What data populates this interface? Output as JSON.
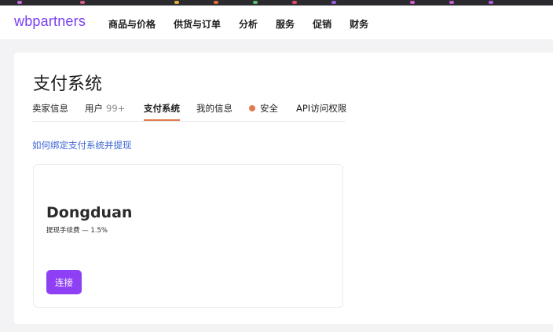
{
  "header": {
    "logo": "wbpartners",
    "nav": [
      "商品与价格",
      "供货与订单",
      "分析",
      "服务",
      "促销",
      "财务"
    ]
  },
  "page": {
    "title": "支付系统",
    "tabs": [
      {
        "label": "卖家信息"
      },
      {
        "label": "用户",
        "count": "99+"
      },
      {
        "label": "支付系统",
        "active": true
      },
      {
        "label": "我的信息"
      },
      {
        "label": "安全",
        "dot_color": "#e07a4f"
      },
      {
        "label": "API访问权限"
      }
    ],
    "help_link": "如何绑定支付系统并提现",
    "card": {
      "title": "Dongduan",
      "subtitle": "提现手续费 — 1.5%",
      "button": "连接"
    }
  },
  "colors": {
    "brand": "#7a3ff2",
    "button": "#8f3ff4",
    "active_tab_underline": "#e0794a",
    "link": "#3b63d6"
  }
}
